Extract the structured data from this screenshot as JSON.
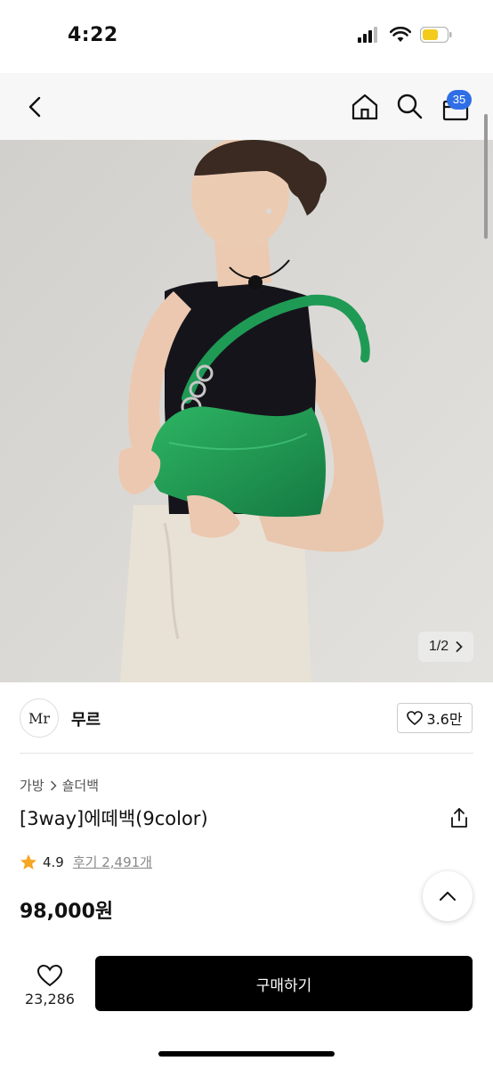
{
  "status": {
    "time": "4:22"
  },
  "nav": {
    "icons": [
      "chevron-left-icon",
      "home-icon",
      "search-icon",
      "cart-icon"
    ],
    "cart_count": "35"
  },
  "gallery": {
    "counter": "1/2",
    "next_icon": "chevron-right-icon"
  },
  "brand": {
    "logo_text": "Mr",
    "name": "무르",
    "like_count": "3.6만"
  },
  "breadcrumb": {
    "category": "가방",
    "subcategory": "숄더백"
  },
  "product": {
    "title": "[3way]에떼백(9color)",
    "rating": "4.9",
    "reviews": "후기 2,491개",
    "price": "98,000원"
  },
  "bottom": {
    "wish_count": "23,286",
    "buy_label": "구매하기"
  },
  "colors": {
    "badge": "#2f6fe6",
    "star": "#f5a623",
    "buy_bg": "#000000",
    "bag": "#1f9a55"
  }
}
